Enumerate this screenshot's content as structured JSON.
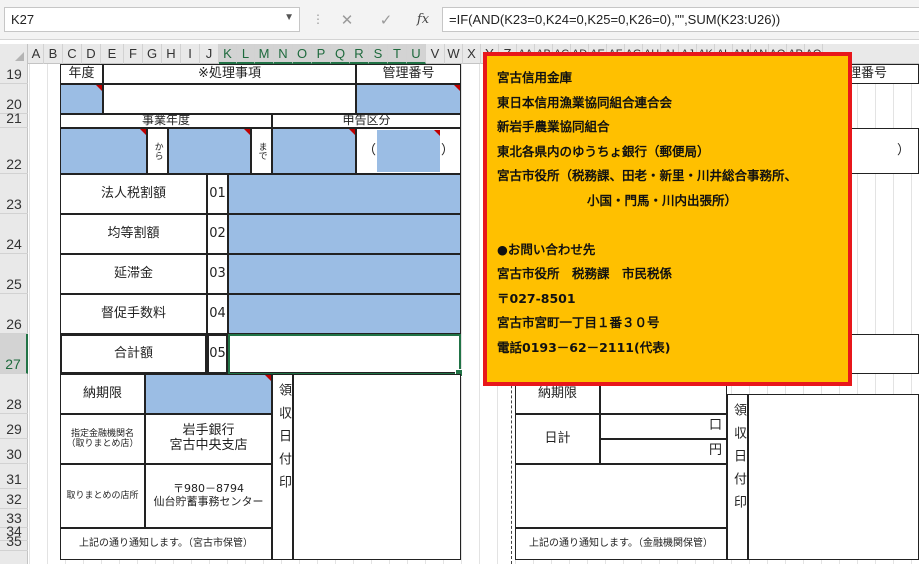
{
  "formula_bar": {
    "name_box": "K27",
    "cancel_icon": "✕",
    "enter_icon": "✓",
    "fx_label": "fx",
    "formula": "=IF(AND(K23=0,K24=0,K25=0,K26=0),\"\",SUM(K23:U26))"
  },
  "columns": [
    "A",
    "B",
    "C",
    "D",
    "E",
    "F",
    "G",
    "H",
    "I",
    "J",
    "K",
    "L",
    "M",
    "N",
    "O",
    "P",
    "Q",
    "R",
    "S",
    "T",
    "U",
    "V",
    "W",
    "X",
    "Y",
    "Z",
    "AA",
    "AB",
    "AC",
    "AD",
    "AE",
    "AF",
    "AG",
    "AH",
    "AI",
    "AJ",
    "AK",
    "AL",
    "AM",
    "AN",
    "AO",
    "AP",
    "AQ"
  ],
  "rows": [
    "19",
    "20",
    "21",
    "22",
    "23",
    "24",
    "25",
    "26",
    "27",
    "28",
    "29",
    "30",
    "31",
    "32",
    "33",
    "34",
    "35"
  ],
  "form_left": {
    "nendo": "年度",
    "shori_jiko": "※処理事項",
    "kanri_bango": "管理番号",
    "jigyo_nendo": "事業年度",
    "shinkoku_kubun": "申告区分",
    "kara": "から",
    "made": "まで",
    "paren_open": "（",
    "paren_close": "）",
    "items": [
      {
        "label": "法人税割額",
        "code": "01"
      },
      {
        "label": "均等割額",
        "code": "02"
      },
      {
        "label": "延滞金",
        "code": "03"
      },
      {
        "label": "督促手数料",
        "code": "04"
      },
      {
        "label": "合計額",
        "code": "05"
      }
    ],
    "nokigen": "納期限",
    "shitei_kinyu": "指定金融機関名\n（取りまとめ店）",
    "bank_name": "岩手銀行",
    "bank_branch": "宮古中央支店",
    "torimatome": "取りまとめの店所",
    "postal": "〒980－8794",
    "postal_center": "仙台貯蓄事務センター",
    "ryoshu_stamp": "領収日付印",
    "notice": "上記の通り通知します。（宮古市保管）"
  },
  "form_right": {
    "kanri_bango_partial": "理番号",
    "paren_close": "）",
    "nokigen": "納期限",
    "nikkei": "日計",
    "kuchi": "口",
    "yen": "円",
    "ryoshu_stamp": "領収日付印",
    "notice": "上記の通り通知します。（金融機関保管）"
  },
  "notice_box": {
    "lines": [
      "宮古信用金庫",
      "東日本信用漁業協同組合連合会",
      "新岩手農業協同組合",
      "東北各県内のゆうちょ銀行（郵便局）",
      "宮古市役所（税務課、田老・新里・川井総合事務所、",
      "小国・門馬・川内出張所）",
      "",
      "●お問い合わせ先",
      "宮古市役所　税務課　市民税係",
      "〒027-8501",
      "宮古市宮町一丁目１番３０号",
      "電話0193－62－2111(代表)"
    ]
  },
  "colors": {
    "input_blue": "#9bbde4",
    "notice_bg": "#ffc000",
    "notice_border": "#e8171b",
    "active_green": "#217346"
  }
}
